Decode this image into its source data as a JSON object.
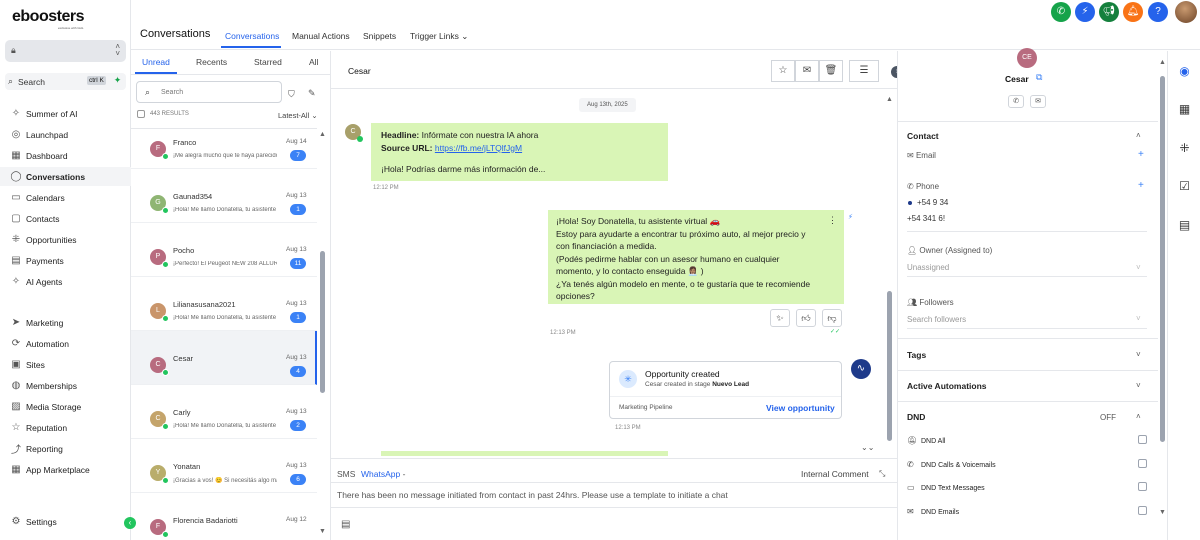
{
  "app": {
    "logo": "eboosters",
    "logo_sub": "exclusive with GHL",
    "search_label": "Search",
    "search_kbd": "ctrl K"
  },
  "nav": [
    {
      "label": "Summer of AI",
      "icon": "sparkle-icon"
    },
    {
      "label": "Launchpad",
      "icon": "rocket-icon"
    },
    {
      "label": "Dashboard",
      "icon": "grid-icon"
    },
    {
      "label": "Conversations",
      "icon": "chat-icon",
      "active": true
    },
    {
      "label": "Calendars",
      "icon": "calendar-icon"
    },
    {
      "label": "Contacts",
      "icon": "contacts-icon"
    },
    {
      "label": "Opportunities",
      "icon": "opportunities-icon"
    },
    {
      "label": "Payments",
      "icon": "payments-icon"
    },
    {
      "label": "AI Agents",
      "icon": "ai-agents-icon"
    },
    {
      "label": "Marketing",
      "icon": "send-icon"
    },
    {
      "label": "Automation",
      "icon": "automation-icon"
    },
    {
      "label": "Sites",
      "icon": "sites-icon"
    },
    {
      "label": "Memberships",
      "icon": "memberships-icon"
    },
    {
      "label": "Media Storage",
      "icon": "media-icon"
    },
    {
      "label": "Reputation",
      "icon": "star-icon"
    },
    {
      "label": "Reporting",
      "icon": "reporting-icon"
    },
    {
      "label": "App Marketplace",
      "icon": "marketplace-icon"
    }
  ],
  "settings_label": "Settings",
  "header": {
    "title": "Conversations",
    "tabs": [
      "Conversations",
      "Manual Actions",
      "Snippets",
      "Trigger Links"
    ]
  },
  "convlist": {
    "tabs": [
      "Unread",
      "Recents",
      "Starred",
      "All"
    ],
    "search_placeholder": "Search",
    "results": "443 RESULTS",
    "sort": "Latest-All",
    "items": [
      {
        "initial": "F",
        "name": "Franco",
        "preview": "¡Me alegra mucho que te haya parecido interesante!",
        "date": "Aug 14",
        "count": "7",
        "color": "#b86b7f"
      },
      {
        "initial": "G",
        "name": "Gaunad354",
        "preview": "¡Hola! Me llamo Donatella, tu asistente virtual",
        "date": "Aug 13",
        "count": "1",
        "color": "#8fb573"
      },
      {
        "initial": "P",
        "name": "Pocho",
        "preview": "¡Perfecto! El Peugeot NEW 208 ALLURE",
        "date": "Aug 13",
        "count": "11",
        "color": "#b86b7f"
      },
      {
        "initial": "L",
        "name": "Lilianasusana2021",
        "preview": "¡Hola! Me llamo Donatella, tu asistente virtual",
        "date": "Aug 13",
        "count": "1",
        "color": "#c9956b"
      },
      {
        "initial": "C",
        "name": "Cesar",
        "preview": "",
        "date": "Aug 13",
        "count": "4",
        "color": "#b86b7f",
        "selected": true
      },
      {
        "initial": "C",
        "name": "Carly",
        "preview": "¡Hola! Me llamo Donatella, tu asistente virtual",
        "date": "Aug 13",
        "count": "2",
        "color": "#c4a46b"
      },
      {
        "initial": "Y",
        "name": "Yonatan",
        "preview": "¡Gracias a vos! 😊 Si necesitás algo más",
        "date": "Aug 13",
        "count": "6",
        "color": "#b9ad6b"
      },
      {
        "initial": "F",
        "name": "Florencia Badariotti",
        "preview": "",
        "date": "Aug 12",
        "count": "",
        "color": "#b86b7f"
      }
    ]
  },
  "chat": {
    "contact_name": "Cesar",
    "date_pill": "Aug 13th, 2025",
    "in_avatar": "C",
    "msg_in": {
      "headline_label": "Headline:",
      "headline": "Infórmate con nuestra IA ahora",
      "source_label": "Source URL:",
      "source_url": "https://fb.me/jLTQlfJgM",
      "body": "¡Hola! Podrías darme más información de...",
      "time": "12:12 PM"
    },
    "msg_out": {
      "lines": [
        "¡Hola! Soy Donatella, tu asistente virtual 🚗",
        "Estoy para ayudarte a encontrar tu próximo auto, al mejor precio y",
        "con financiación a medida.",
        "(Podés pedirme hablar con un asesor humano en cualquier",
        "momento, y lo contacto enseguida 👩🏽‍💼 )",
        "¿Ya tenés algún modelo en mente, o te gustaría que te recomiende",
        "opciones?"
      ],
      "time": "12:13 PM"
    },
    "opportunity": {
      "title": "Opportunity created",
      "sub_prefix": "Cesar created in stage",
      "stage": "Nuevo Lead",
      "pipeline": "Marketing Pipeline",
      "link": "View opportunity",
      "time": "12:13 PM"
    },
    "composer": {
      "tab_sms": "SMS",
      "tab_whatsapp": "WhatsApp",
      "internal": "Internal Comment",
      "notice": "There has been no message initiated from contact in past 24hrs. Please use a  template to initiate a chat"
    }
  },
  "contact": {
    "initials": "CE",
    "name": "Cesar",
    "section_contact": "Contact",
    "email_label": "Email",
    "phone_label": "Phone",
    "phone1": "+54 9 34",
    "phone2": "+54 341 6!",
    "owner_label": "Owner (Assigned to)",
    "owner_value": "Unassigned",
    "followers_label": "Followers",
    "followers_placeholder": "Search followers",
    "tags": "Tags",
    "automations": "Active Automations",
    "dnd": "DND",
    "dnd_state": "OFF",
    "dnd_items": [
      {
        "label": "DND All",
        "icon": "bell-off-icon"
      },
      {
        "label": "DND Calls & Voicemails",
        "icon": "phone-icon"
      },
      {
        "label": "DND Text Messages",
        "icon": "message-icon"
      },
      {
        "label": "DND Emails",
        "icon": "mail-icon"
      }
    ]
  },
  "colors": {
    "accent": "#2563eb",
    "bubble": "#d9f5b6",
    "badge": "#3b82f6"
  }
}
